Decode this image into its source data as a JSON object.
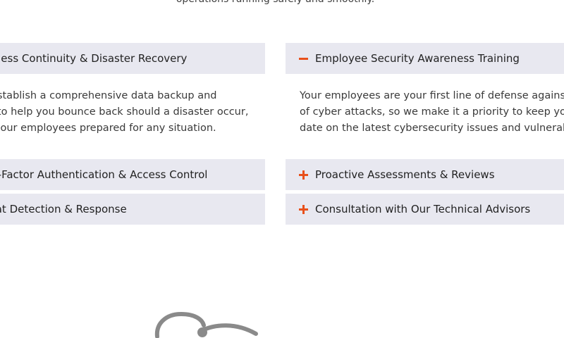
{
  "intro": {
    "text": "operations running safely and smoothly."
  },
  "accordion_left": {
    "items": [
      {
        "title": "Business Continuity & Disaster Recovery",
        "expanded": true,
        "body_lines": [
          "We establish a comprehensive data backup and",
          "plan to help you bounce back should a disaster occur,",
          "and your employees prepared for any situation."
        ]
      },
      {
        "title": "Multi-Factor Authentication & Access Control",
        "expanded": false
      },
      {
        "title": "Threat Detection & Response",
        "expanded": false
      }
    ]
  },
  "accordion_right": {
    "items": [
      {
        "title": "Employee Security Awareness Training",
        "expanded": true,
        "icon": "minus-icon",
        "body_lines": [
          "Your employees are your first line of defense against",
          "of cyber attacks, so we make it a priority to keep your",
          "date on the latest cybersecurity issues and vulnerabil"
        ]
      },
      {
        "title": "Proactive Assessments & Reviews",
        "expanded": false,
        "icon": "plus-icon"
      },
      {
        "title": "Consultation with Our Technical Advisors",
        "expanded": false,
        "icon": "plus-icon"
      }
    ]
  },
  "colors": {
    "accent": "#e8501b",
    "header_bg": "#e8e8f0"
  }
}
